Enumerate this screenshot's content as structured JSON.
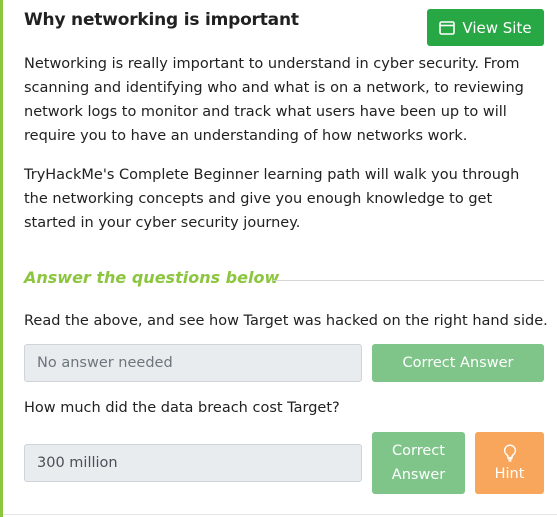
{
  "header": {
    "title": "Why networking is important",
    "view_site_label": "View Site",
    "view_site_icon": "window-icon"
  },
  "content": {
    "paragraph_1": "Networking is really important to understand in cyber security. From scanning and identifying who and what is on a network, to reviewing network logs to monitor and track what users have been up to will require you to have an understanding of how networks work.",
    "paragraph_2": "TryHackMe's Complete Beginner learning path will walk you through the networking concepts and give you enough knowledge to get started in your cyber security journey."
  },
  "questions": {
    "heading": "Answer the questions below",
    "items": [
      {
        "question": "Read the above, and see how Target was hacked on the right hand side.",
        "answer_placeholder": "No answer needed",
        "answer_value": "",
        "submit_label": "Correct Answer"
      },
      {
        "question": "How much did the data breach cost Target?",
        "answer_placeholder": "",
        "answer_value": "300 million",
        "submit_label_line1": "Correct",
        "submit_label_line2": "Answer",
        "hint_label": "Hint",
        "hint_icon": "lightbulb-icon"
      }
    ]
  },
  "colors": {
    "accent_green": "#8cc63f",
    "view_site_green": "#28a745",
    "correct_green": "#7fc58a",
    "hint_orange": "#f8a65c"
  }
}
